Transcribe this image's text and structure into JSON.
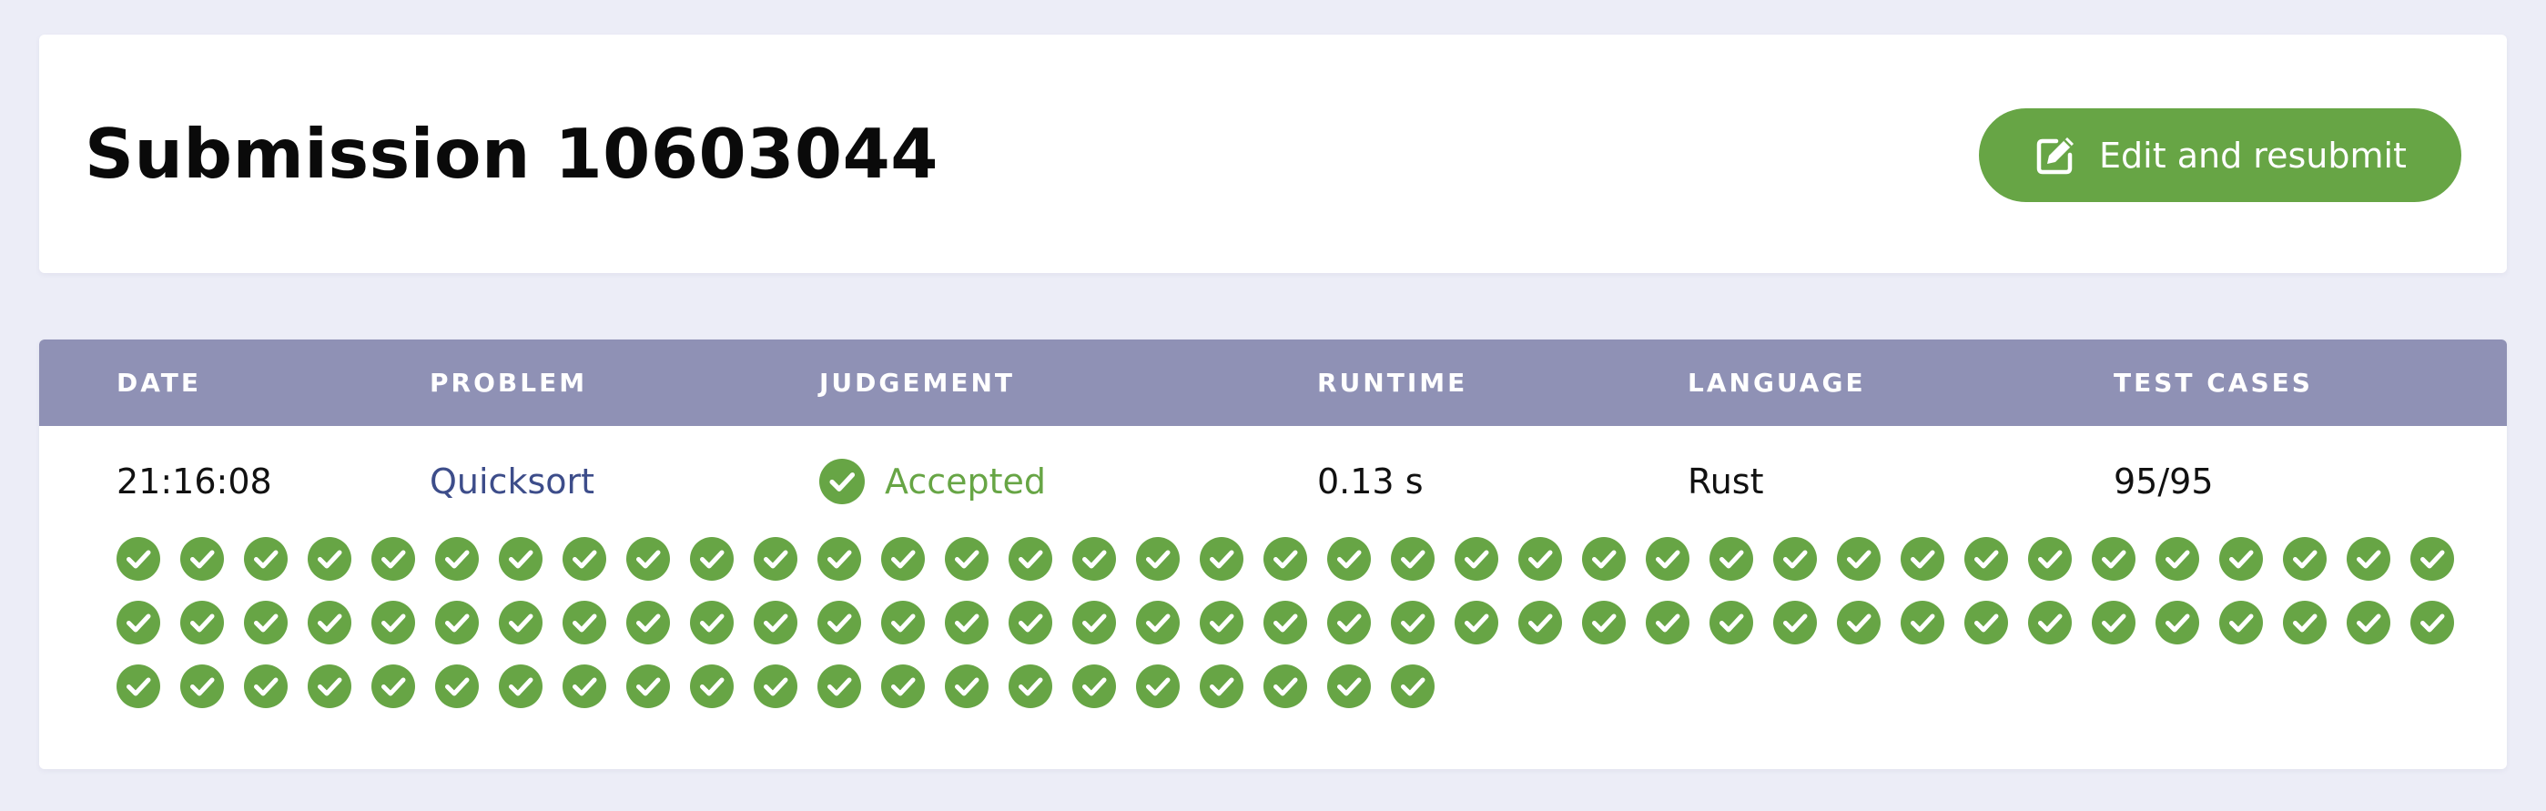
{
  "header": {
    "title": "Submission 10603044",
    "resubmit_label": "Edit and resubmit",
    "resubmit_icon": "edit-icon"
  },
  "table": {
    "columns": [
      "DATE",
      "PROBLEM",
      "JUDGEMENT",
      "RUNTIME",
      "LANGUAGE",
      "TEST CASES"
    ],
    "row": {
      "date": "21:16:08",
      "problem": "Quicksort",
      "judgement": "Accepted",
      "runtime": "0.13 s",
      "language": "Rust",
      "test_cases": "95/95"
    }
  },
  "test_cases": {
    "passed": 95,
    "total": 95,
    "icon": "check-circle-icon"
  },
  "colors": {
    "accent_green": "#67a545",
    "table_header": "#8f91b5",
    "link": "#3d4d8a",
    "page_background": "#ecedf7"
  }
}
